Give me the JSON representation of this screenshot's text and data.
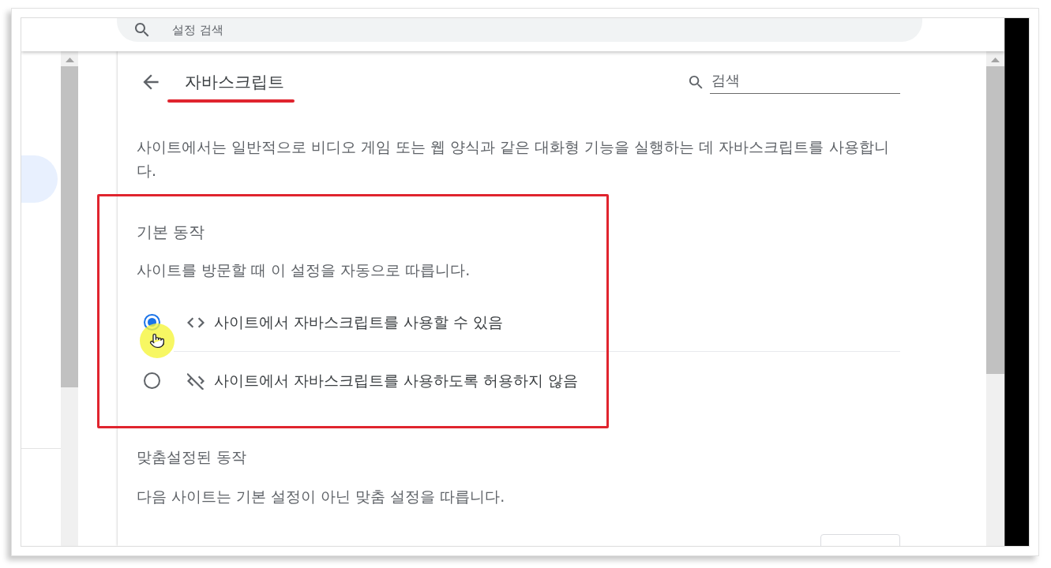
{
  "top_bar": {
    "search": {
      "placeholder": "설정 검색"
    }
  },
  "page": {
    "title": "자바스크립트",
    "search": {
      "placeholder": "검색"
    },
    "description": "사이트에서는 일반적으로 비디오 게임 또는 웹 양식과 같은 대화형 기능을 실행하는 데 자바스크립트를 사용합니다."
  },
  "default_behavior": {
    "heading": "기본 동작",
    "subtitle": "사이트를 방문할 때 이 설정을 자동으로 따릅니다.",
    "options": [
      {
        "kind": "allow",
        "label": "사이트에서 자바스크립트를 사용할 수 있음",
        "selected": true
      },
      {
        "kind": "block",
        "label": "사이트에서 자바스크립트를 사용하도록 허용하지 않음",
        "selected": false
      }
    ]
  },
  "custom_behavior": {
    "heading": "맞춤설정된 동작",
    "subtitle": "다음 사이트는 기본 설정이 아닌 맞춤 설정을 따릅니다."
  }
}
